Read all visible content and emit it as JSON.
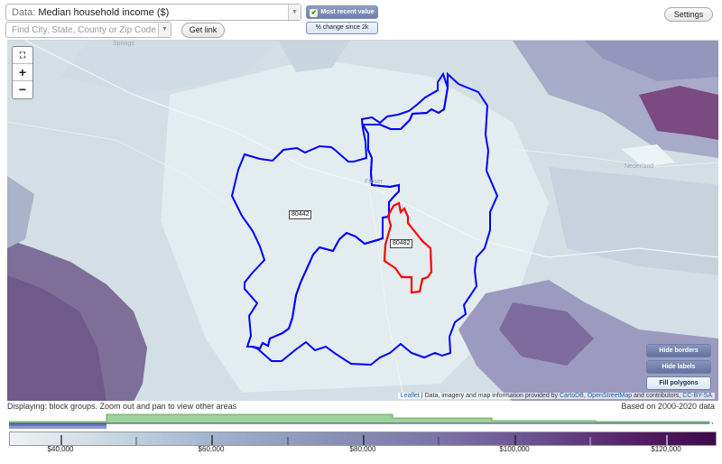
{
  "toolbar": {
    "data_label": "Data:",
    "data_value": "Median household income ($)",
    "search_placeholder": "Find City, State, County or Zip Code",
    "get_link": "Get link",
    "most_recent": "Most recent value",
    "pct_change": "% change since 2k",
    "settings": "Settings"
  },
  "map": {
    "zip_labels": [
      "80442",
      "80482"
    ],
    "places": [
      "Springs",
      "Fraser",
      "Nederland"
    ],
    "zoom": {
      "fit": "fit-icon",
      "in": "+",
      "out": "−"
    },
    "buttons": {
      "hide_borders": "Hide borders",
      "hide_labels": "Hide labels",
      "fill_polygons": "Fill polygons"
    },
    "attribution": {
      "leaflet": "Leaflet",
      "text1": " | Data, imagery and map information provided by ",
      "cartodb": "CartoDB",
      "sep": ", ",
      "osm": "OpenStreetMap",
      "text2": " and contributors, ",
      "license": "CC-BY-SA"
    },
    "colors": {
      "border_80442": "#0000ff",
      "border_80482": "#ff0000"
    }
  },
  "footer": {
    "status": "Displaying: block groups. Zoom out and pan to view other areas",
    "based_on": "Based on 2000-2020 data"
  },
  "legend": {
    "ticks": [
      "$40,000",
      "$60,000",
      "$80,000",
      "$100,000",
      "$120,000"
    ]
  }
}
